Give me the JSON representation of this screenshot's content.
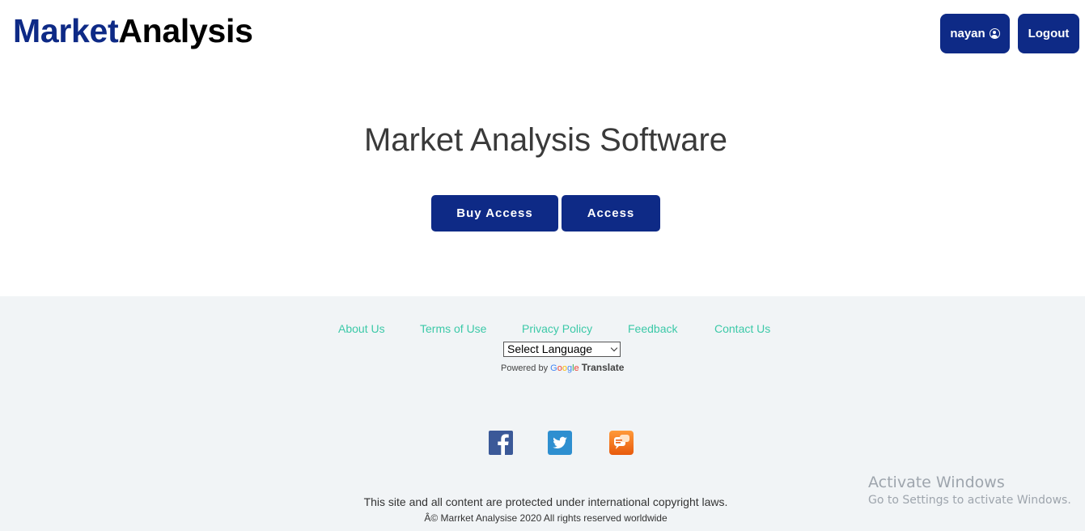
{
  "header": {
    "logo_part1": "Market",
    "logo_part2": "Analysis",
    "user_label": "nayan",
    "logout_label": "Logout"
  },
  "hero": {
    "title": "Market Analysis Software",
    "buy_label": "Buy Access",
    "access_label": "Access"
  },
  "footer": {
    "links": [
      "About Us",
      "Terms of Use",
      "Privacy Policy",
      "Feedback",
      "Contact Us"
    ],
    "language_select": "Select Language",
    "powered_by": "Powered by",
    "google": "Google",
    "translate": "Translate",
    "social": [
      "facebook-icon",
      "twitter-icon",
      "blogger-icon"
    ],
    "legal_line1": "This site and all content are protected under international copyright laws.",
    "legal_line2": "Â© Marrket Analysise 2020 All rights reserved worldwide"
  },
  "watermark": {
    "line1": "Activate Windows",
    "line2": "Go to Settings to activate Windows."
  },
  "colors": {
    "brand_navy": "#0e2a86",
    "link_teal": "#3cc9a8",
    "footer_bg": "#f1f4f6"
  }
}
